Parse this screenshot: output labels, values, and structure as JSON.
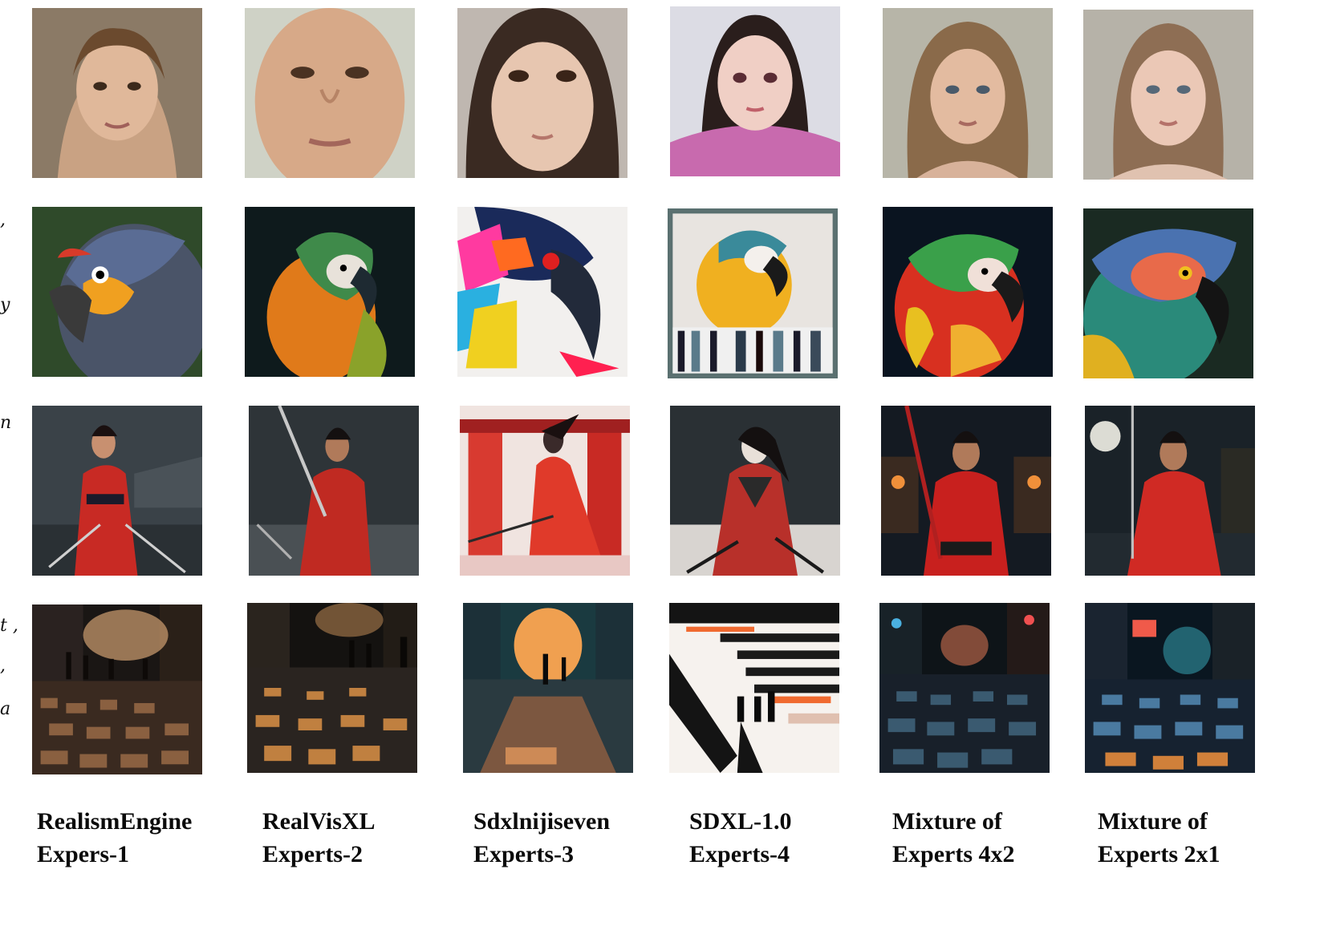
{
  "rows": [
    {
      "subject": "girl portrait"
    },
    {
      "subject": "parrot"
    },
    {
      "subject": "samurai in red kimono in the rain"
    },
    {
      "subject": "wet cobblestone street at night"
    }
  ],
  "left_fragments": [
    ",",
    "y",
    "n",
    "t ,",
    ",",
    "a"
  ],
  "models": [
    {
      "name": "RealismEngine",
      "role": "Expers-1"
    },
    {
      "name": "RealVisXL",
      "role": "Experts-2"
    },
    {
      "name": "Sdxlnijiseven",
      "role": "Experts-3"
    },
    {
      "name": "SDXL-1.0",
      "role": "Experts-4"
    },
    {
      "name": "Mixture of",
      "role": "Experts 4x2"
    },
    {
      "name": "Mixture of",
      "role": "Experts 2x1"
    }
  ],
  "colors": {
    "label_text": "#0b0b0b",
    "background": "#ffffff"
  }
}
